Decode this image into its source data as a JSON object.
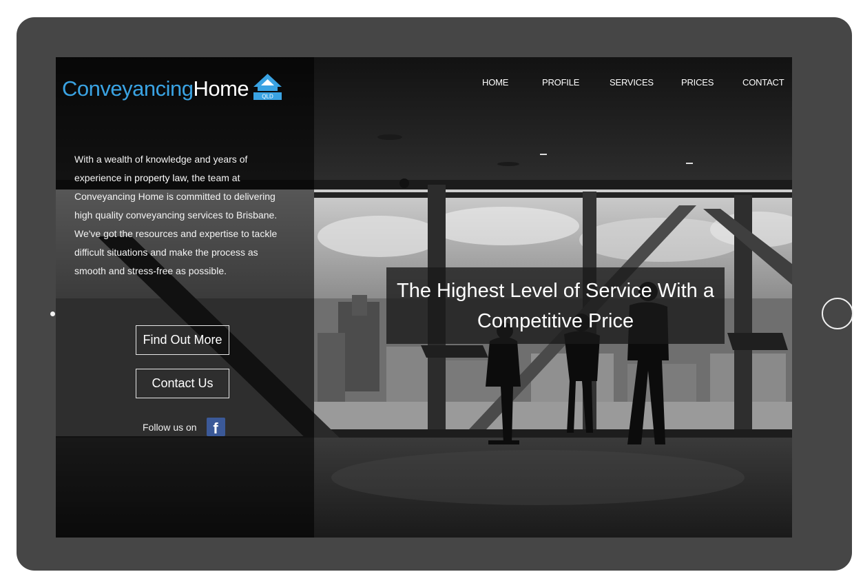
{
  "brand": {
    "name_part1": "Conveyancing",
    "name_part2": "Home",
    "badge": "QLD",
    "accent_color": "#3aa3e3"
  },
  "nav": {
    "items": [
      {
        "label": "HOME"
      },
      {
        "label": "PROFILE"
      },
      {
        "label": "SERVICES"
      },
      {
        "label": "PRICES"
      },
      {
        "label": "CONTACT"
      }
    ]
  },
  "intro": {
    "text_before": "With a wealth of knowledge and years of experience in ",
    "highlight": "property law",
    "text_after": ", the team at Conveyancing Home is committed to delivering high quality conveyancing services to Brisbane. We've got the resources and expertise to tackle difficult situations and make the process as smooth and stress-free as possible."
  },
  "buttons": {
    "find_out_more": "Find Out More",
    "contact_us": "Contact Us"
  },
  "social": {
    "follow_label": "Follow us on",
    "facebook_icon": "facebook-icon",
    "facebook_glyph": "f"
  },
  "hero": {
    "headline": "The Highest Level of Service With a Competitive Price"
  }
}
